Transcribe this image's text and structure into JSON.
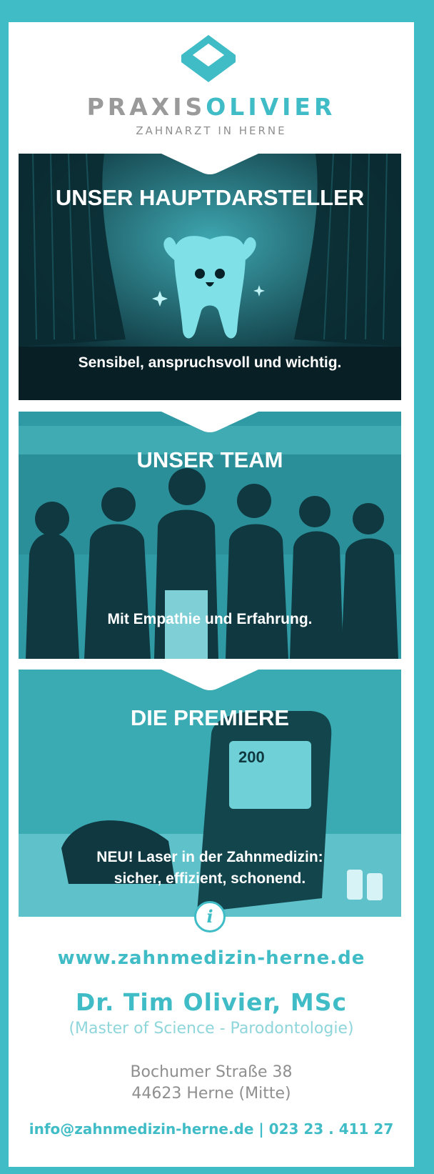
{
  "brand": {
    "name_part1": "PRAXIS",
    "name_part2": "OLIVIER",
    "subtitle": "ZAHNARZT IN HERNE"
  },
  "panels": [
    {
      "title": "UNSER HAUPTDARSTELLER",
      "text": "Sensibel, anspruchsvoll und wichtig."
    },
    {
      "title": "UNSER TEAM",
      "text": "Mit Empathie und Erfahrung."
    },
    {
      "title": "DIE PREMIERE",
      "line1": "NEU! Laser in der Zahnmedizin:",
      "line2": "sicher, effizient, schonend.",
      "display": "200"
    }
  ],
  "info_icon": "i",
  "contact": {
    "url": "www.zahnmedizin-herne.de",
    "doctor": "Dr. Tim Olivier, MSc",
    "degree": "(Master of Science - Parodontologie)",
    "street": "Bochumer Straße 38",
    "city": "44623 Herne (Mitte)",
    "email_phone": "info@zahnmedizin-herne.de | 023 23 . 411 27"
  },
  "colors": {
    "accent": "#3fbcc6",
    "grey": "#8f8f8f",
    "light_accent": "#8fd6db"
  },
  "icons": [
    "logo-diamond-icon",
    "tooth-mascot-icon",
    "sparkle-icon",
    "info-icon"
  ]
}
